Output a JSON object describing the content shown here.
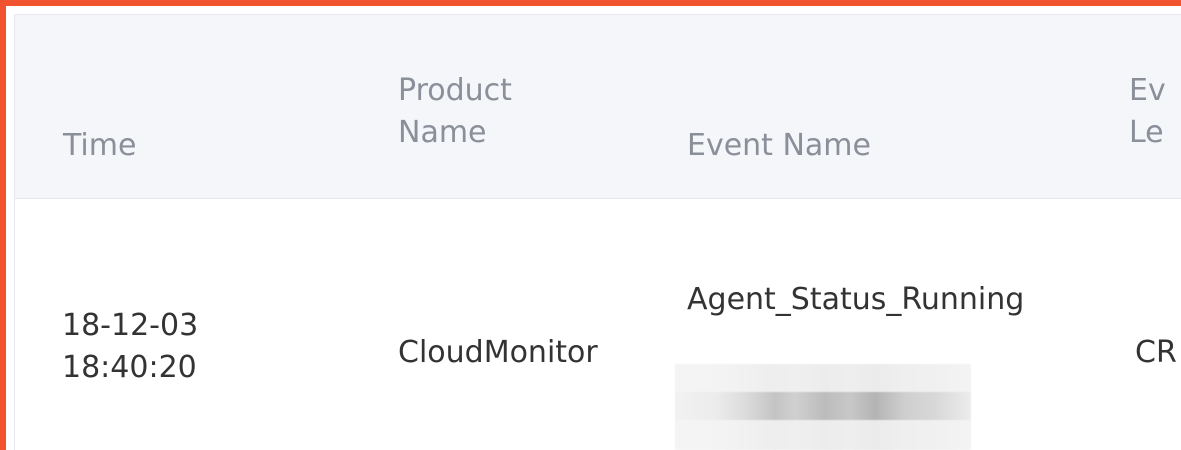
{
  "table": {
    "columns": [
      {
        "key": "time",
        "label": "Time"
      },
      {
        "key": "product_name",
        "label": "Product\nName"
      },
      {
        "key": "event_name",
        "label": "Event Name"
      },
      {
        "key": "event_level",
        "label": "Ev\nLe"
      }
    ],
    "rows": [
      {
        "time": "18-12-03\n18:40:20",
        "product_name": "CloudMonitor",
        "event_name": "Agent_Status_Running",
        "event_level": "CR"
      }
    ]
  },
  "colors": {
    "highlight_border": "#f0532d",
    "header_background": "#f5f6fa",
    "header_text": "#8a8f99",
    "body_text": "#333333"
  }
}
